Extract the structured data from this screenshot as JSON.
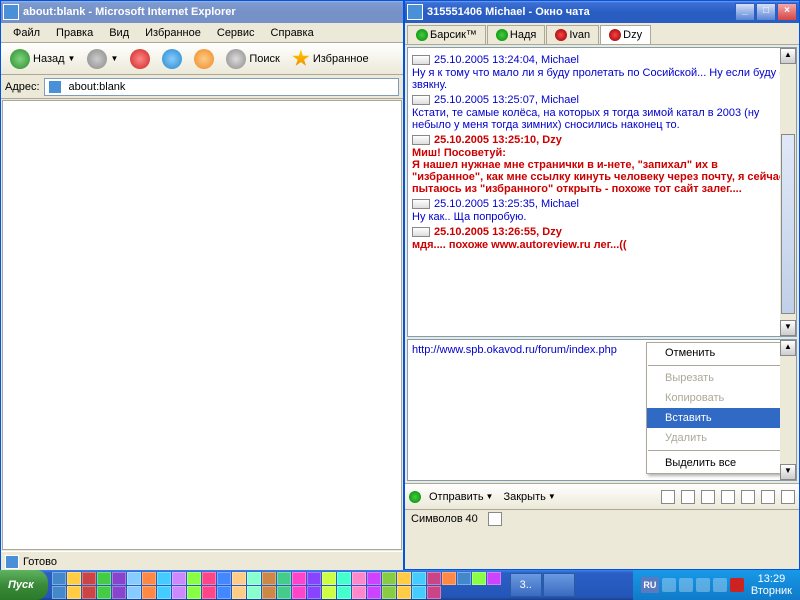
{
  "ie": {
    "title": "about:blank - Microsoft Internet Explorer",
    "menu": [
      "Файл",
      "Правка",
      "Вид",
      "Избранное",
      "Сервис",
      "Справка"
    ],
    "back": "Назад",
    "search": "Поиск",
    "favorites": "Избранное",
    "addressLabel": "Адрес:",
    "addressValue": "about:blank",
    "status": "Готово"
  },
  "chat": {
    "title": "315551406 Michael - Окно чата",
    "tabs": [
      {
        "label": "Барсик™",
        "icon": "g"
      },
      {
        "label": "Надя",
        "icon": "g"
      },
      {
        "label": "Ivan",
        "icon": "r"
      },
      {
        "label": "Dzy",
        "icon": "r"
      }
    ],
    "messages": [
      {
        "ts": "25.10.2005 13:24:04, Michael",
        "body": "Ну я к тому что мало ли я буду пролетать по Сосийской... Ну если буду - я звякну.",
        "red": false
      },
      {
        "ts": "25.10.2005 13:25:07, Michael",
        "body": "Кстати, те самые колёса, на которых я тогда зимой катал в 2003 (ну небыло у меня тогда зимних) сносились наконец то.",
        "red": false
      },
      {
        "ts": "25.10.2005 13:25:10, Dzy",
        "body": "Миш! Посоветуй:\nЯ нашел нужнае мне странички в и-нете, \"запихал\" их в \"избранное\", как мне ссылку кинуть человеку через почту, я сейчас пытаюсь из \"избранного\" открыть - похоже тот сайт залег....",
        "red": true
      },
      {
        "ts": "25.10.2005 13:25:35, Michael",
        "body": "Ну как.. Ща попробую.",
        "red": false
      },
      {
        "ts": "25.10.2005 13:26:55, Dzy",
        "body": "мдя.... похоже www.autoreview.ru лег...((",
        "red": true
      }
    ],
    "inputText": "http://www.spb.okavod.ru/forum/index.php",
    "contextMenu": {
      "items": [
        "Отменить",
        "Вырезать",
        "Копировать",
        "Вставить",
        "Удалить",
        "Выделить все"
      ],
      "highlight": 3,
      "disabled": [
        1,
        2,
        4
      ]
    },
    "sendBtn": "Отправить",
    "closeBtn": "Закрыть",
    "charCountLabel": "Символов",
    "charCount": "40"
  },
  "taskbar": {
    "start": "Пуск",
    "task1": "3..",
    "lang": "RU",
    "time": "13:29",
    "day": "Вторник"
  }
}
